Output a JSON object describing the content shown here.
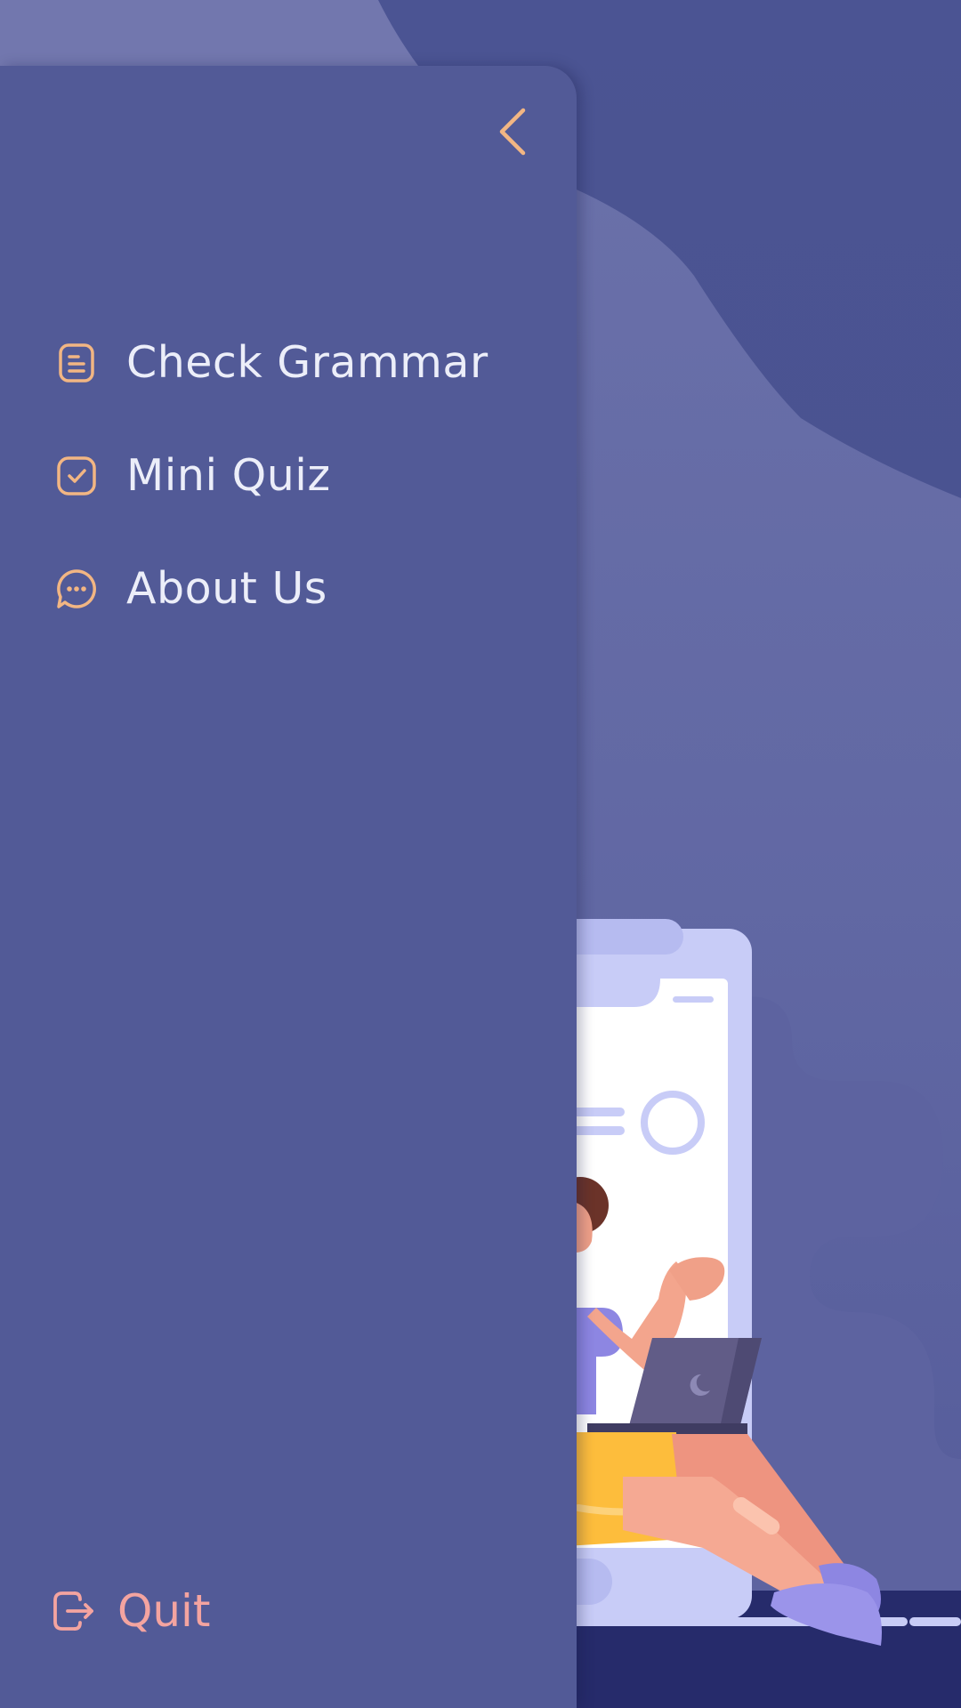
{
  "drawer": {
    "close_icon": "chevron-left-icon",
    "menu": [
      {
        "icon": "document-icon",
        "label": "Check Grammar"
      },
      {
        "icon": "checkbox-icon",
        "label": "Mini Quiz"
      },
      {
        "icon": "chat-bubble-icon",
        "label": "About Us"
      }
    ],
    "quit": {
      "icon": "logout-icon",
      "label": "Quit"
    }
  },
  "colors": {
    "background": "#4c5593",
    "drawer": "#525a97",
    "accent_icon": "#f2b683",
    "menu_text": "#eceef9",
    "quit": "#f4a4a0"
  }
}
